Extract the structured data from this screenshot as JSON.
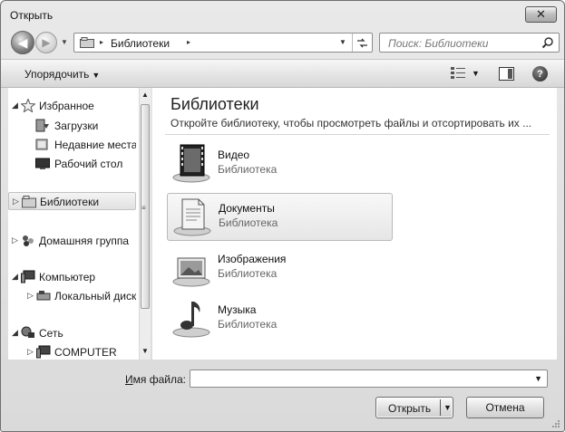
{
  "window": {
    "title": "Открыть",
    "close_label": "✕"
  },
  "nav": {
    "back_glyph": "◀",
    "forward_glyph": "▶",
    "address": {
      "path": [
        "Библиотеки"
      ],
      "separator": "▸"
    },
    "search": {
      "placeholder": "Поиск: Библиотеки"
    }
  },
  "toolbar": {
    "organize_label": "Упорядочить",
    "caret": "▼",
    "help_glyph": "?"
  },
  "sidebar": {
    "items": [
      {
        "label": "Избранное",
        "icon": "star-icon",
        "expand": "◢"
      },
      {
        "label": "Загрузки",
        "icon": "downloads-icon"
      },
      {
        "label": "Недавние места",
        "icon": "recent-places-icon"
      },
      {
        "label": "Рабочий стол",
        "icon": "desktop-icon"
      },
      {
        "label": "Библиотеки",
        "icon": "libraries-icon",
        "expand": "▷",
        "selected": true
      },
      {
        "label": "Домашняя группа",
        "icon": "homegroup-icon",
        "expand": "▷"
      },
      {
        "label": "Компьютер",
        "icon": "computer-icon",
        "expand": "◢"
      },
      {
        "label": "Локальный диск",
        "icon": "local-disk-icon",
        "expand": "▷"
      },
      {
        "label": "Сеть",
        "icon": "network-icon",
        "expand": "◢"
      },
      {
        "label": "COMPUTER",
        "icon": "network-computer-icon",
        "expand": "▷"
      }
    ],
    "scroll_up": "▲",
    "scroll_down": "▼",
    "scroll_grip": "≡"
  },
  "content": {
    "title": "Библиотеки",
    "description": "Откройте библиотеку, чтобы просмотреть файлы и отсортировать их ...",
    "libraries": [
      {
        "name": "Видео",
        "type": "Библиотека",
        "icon": "video-library-icon"
      },
      {
        "name": "Документы",
        "type": "Библиотека",
        "icon": "documents-library-icon",
        "selected": true
      },
      {
        "name": "Изображения",
        "type": "Библиотека",
        "icon": "pictures-library-icon"
      },
      {
        "name": "Музыка",
        "type": "Библиотека",
        "icon": "music-library-icon"
      }
    ]
  },
  "bottom": {
    "filename_label_underlined": "И",
    "filename_label_rest": "мя файла:",
    "filename_value": "",
    "open_label": "Открыть",
    "cancel_label": "Отмена"
  }
}
